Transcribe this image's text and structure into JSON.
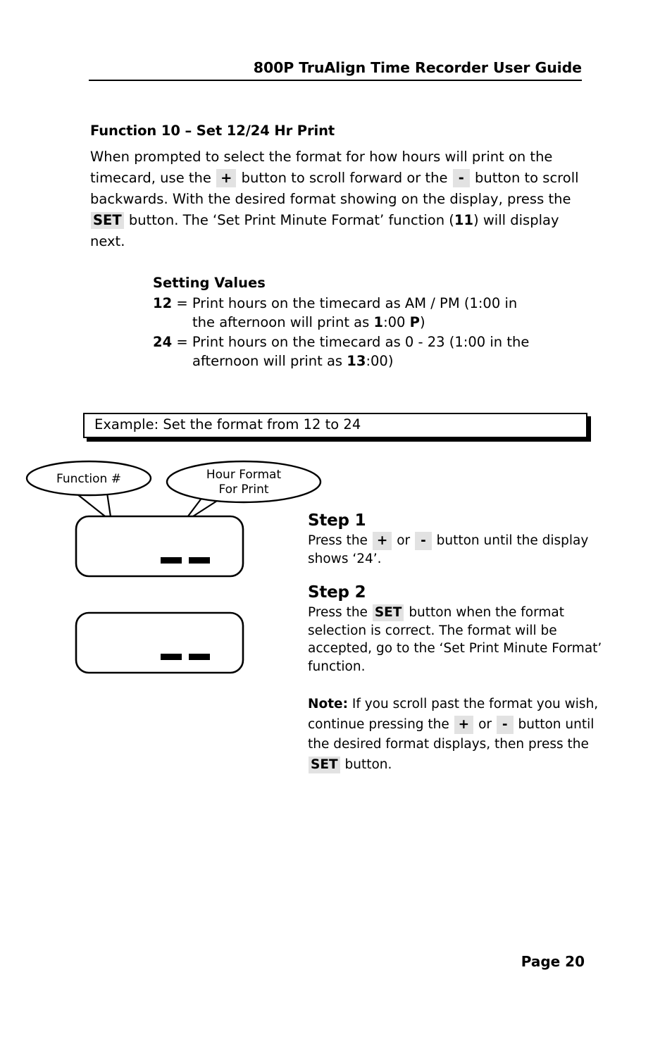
{
  "header": {
    "title": "800P TruAlign Time Recorder User Guide"
  },
  "section": {
    "heading": "Function 10 – Set 12/24 Hr Print",
    "intro": {
      "part1": "When prompted to select the format for how hours will print on the timecard, use the",
      "key_plus": "+",
      "part2": "button to scroll forward or the",
      "key_minus": "-",
      "part3": "button to scroll backwards. With the desired format showing on the display, press the",
      "key_set": "SET",
      "part4": "button. The ‘Set Print Minute Format’ function (",
      "function_ref": "11",
      "part5": ") will display next."
    }
  },
  "setting_values": {
    "title": "Setting Values",
    "rows": [
      {
        "value": "12",
        "text_line1": "= Print hours on the timecard as AM / PM (1:00 in",
        "cont_prefix": "the afternoon will print as ",
        "cont_bold": "1",
        "cont_mid": ":00 ",
        "cont_bold2": "P",
        "cont_suffix": ")"
      },
      {
        "value": "24",
        "text_line1": "= Print hours on the timecard as 0 - 23 (1:00 in the",
        "cont_prefix": "afternoon will print as ",
        "cont_bold": "13",
        "cont_mid": ":00",
        "cont_bold2": "",
        "cont_suffix": ")"
      }
    ]
  },
  "example": {
    "label": "Example: Set the format from 12 to 24"
  },
  "figure": {
    "callout_function": "Function #",
    "callout_hour_line1": "Hour Format",
    "callout_hour_line2": "For Print",
    "display_top_segments": "— —",
    "display_bottom_segments": "— —"
  },
  "steps": [
    {
      "title": "Step 1",
      "part1": "Press the",
      "key_plus": "+",
      "part2": "or",
      "key_minus": "-",
      "part3": "button until the display shows ‘24’."
    },
    {
      "title": "Step 2",
      "part1": "Press the",
      "key_set": "SET",
      "part2": "button when the format selection is correct. The format will be accepted, go to the ‘Set Print Minute Format’ function."
    }
  ],
  "note": {
    "label": "Note:",
    "part1": "If you scroll past the format you wish, continue pressing the",
    "key_plus": "+",
    "part2": "or",
    "key_minus": "-",
    "part3": "button until the desired format displays, then press the",
    "key_set": "SET",
    "part4": "button."
  },
  "footer": {
    "page": "Page 20"
  }
}
